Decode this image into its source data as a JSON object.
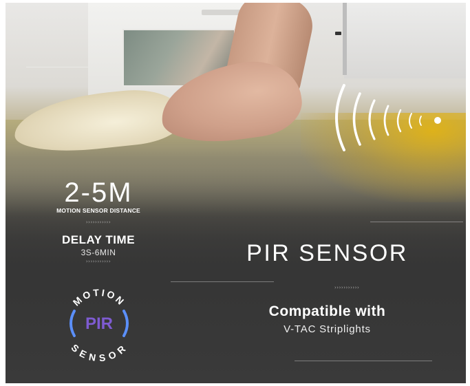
{
  "distance": {
    "value": "2-5M",
    "caption": "MOTION SENSOR DISTANCE"
  },
  "delay": {
    "title": "DELAY TIME",
    "value": "3S-6MIN"
  },
  "separators": {
    "chevrons": "›››››››››››"
  },
  "badge": {
    "top_arc": "MOTION",
    "center": "PIR",
    "bottom_arc": "SENSOR",
    "accent_color": "#5b8ff9",
    "pir_color": "#7e5bd1"
  },
  "headline": {
    "title": "PIR SENSOR",
    "compat_title": "Compatible with",
    "compat_sub": "V-TAC Striplights"
  },
  "icons": {
    "wave": "signal-waves-icon"
  },
  "colors": {
    "floor_accent": "#e6b40a",
    "text": "#ffffff"
  }
}
